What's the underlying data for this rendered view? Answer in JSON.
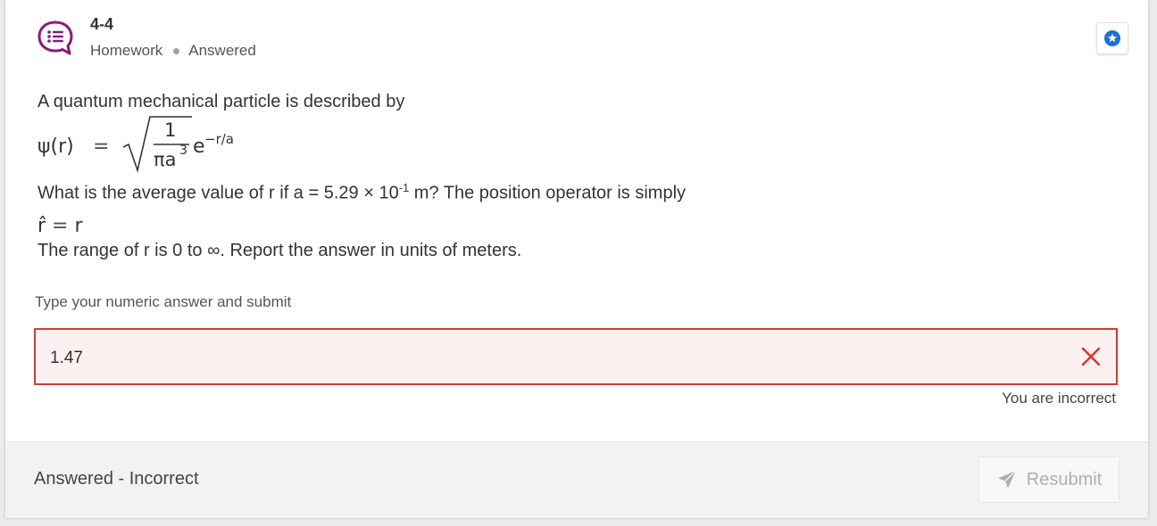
{
  "header": {
    "title": "4-4",
    "type": "Homework",
    "status": "Answered",
    "icon": "question-list-icon",
    "bookmark_icon": "star-badge-icon"
  },
  "question": {
    "intro": "A quantum mechanical particle is described by",
    "formula": {
      "lhs": "ψ(r)",
      "equals": "=",
      "numerator": "1",
      "denominator_base": "πa",
      "denominator_exp": "3",
      "exp_base": "e",
      "exp_power": "−r/a"
    },
    "line2_before": "What is the average value of r if a = 5.29 × 10",
    "line2_exp": "-1",
    "line2_after": " m? The position operator is simply",
    "operator": {
      "lhs": "r̂",
      "equals": "=",
      "rhs": "r"
    },
    "line4": "The range of r is 0 to ∞. Report the answer in units of meters."
  },
  "answer": {
    "prompt": "Type your numeric answer and submit",
    "value": "1.47",
    "feedback": "You are incorrect"
  },
  "footer": {
    "status": "Answered - Incorrect",
    "resubmit_label": "Resubmit"
  },
  "colors": {
    "accent_purple": "#8b1a7a",
    "error_red": "#d03a3a",
    "error_bg": "#fdf0f0",
    "bookmark_blue": "#1d6fd6"
  }
}
